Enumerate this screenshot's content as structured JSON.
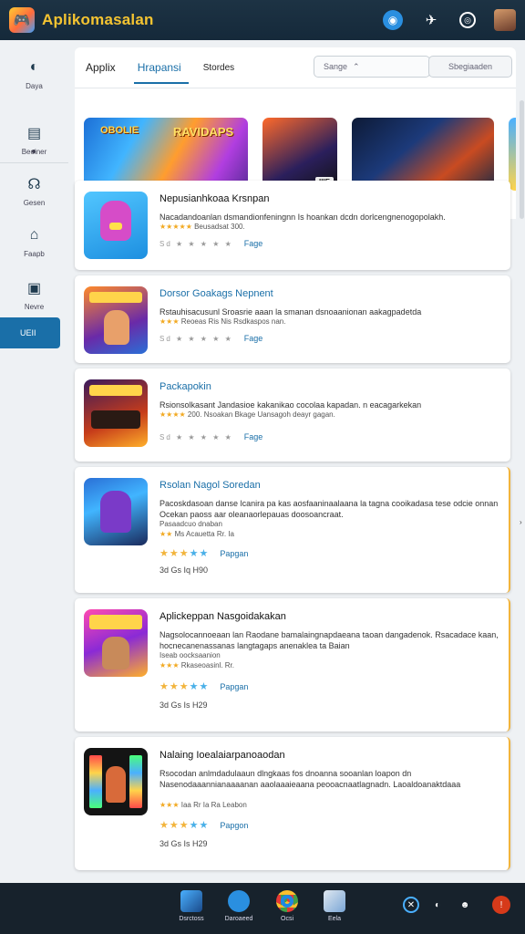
{
  "header": {
    "title": "Aplikomasalan",
    "icons": [
      "shield-icon",
      "rocket-icon",
      "copyright-icon",
      "user-avatar"
    ]
  },
  "sidebar": {
    "items": [
      {
        "label": "Daya",
        "icon": "compass-icon"
      },
      {
        "label": "Beoiner",
        "icon": "inbox-icon"
      },
      {
        "label": "Gesen",
        "icon": "headphones-icon"
      },
      {
        "label": "Faapb",
        "icon": "home-icon"
      },
      {
        "label": "Nevre",
        "icon": "book-icon"
      }
    ],
    "active_label": "UEII"
  },
  "tabs": [
    {
      "label": "Applix"
    },
    {
      "label": "Hrapansi"
    },
    {
      "label": "Stordes"
    }
  ],
  "search": {
    "value": "Sange",
    "button_label": "Sbegiaaden"
  },
  "banners": {
    "b1_text1": "OBOLIE",
    "b1_text2": "RAVIDAPS",
    "b2_tag": "IIIE"
  },
  "apps": [
    {
      "name": "Nepusianhkoaa Krsnpan",
      "desc": "Nacadandoanlan dsmandionfeningnn Is hoankan dcdn dorlcengnenogopolakh.",
      "meta_stars": "★★★★★",
      "meta_text": "Beusadsat 300.",
      "rating": "Sd ★ ★ ★ ★ ★",
      "page": "Fage"
    },
    {
      "name": "Dorsor Goakags Nepnent",
      "desc": "Rstauhisacusunl Sroasrie aaan la smanan dsnoaanionan aakagpadetda",
      "meta_stars": "★★★",
      "meta_text": "Reoeas  Ris  Nis  Rsdkaspos nan.",
      "rating": "Sd ★ ★ ★ ★ ★",
      "page": "Fage"
    },
    {
      "name": "Packapokin",
      "desc": "Rsionsolkasant Jandasioe kakanikao cocolaa kapadan. n eacagarkekan",
      "meta_stars": "★★★★",
      "meta_text": "Nsoakan Bkage Uansagoh deayr gagan.",
      "rating": "Sd ★ ★ ★ ★ ★",
      "page": "Fage",
      "size": "200."
    },
    {
      "name": "Rsolan Nagol Soredan",
      "desc": "Pacoskdasoan danse lcanira pa kas aosfaaninaalaana la tagna cooikadasa tese odcie onnan Ocekan paoss aar oleanaorlepauas doosoancraat.",
      "meta_text": "Pasaadcuo dnaban",
      "meta_stars": "★★",
      "meta_text2": "Ms Acauetta Rr. Ia",
      "rating": "★★★★★",
      "page": "Papgan",
      "size": "3d  Gs  Iq  H90"
    },
    {
      "name": "Aplickeppan Nasgoidakakan",
      "desc": "Nagsolocannoeaan lan Raodane  bamalaingnapdaeana taoan dangadenok. Rsacadace kaan, hocnecanenassanas langtagaps anenaklea ta Baian",
      "meta_text": "Iseab oocksaanion",
      "meta_stars": "★★★",
      "meta_text2": "Rkaseoasinl. Rr.",
      "rating": "★★★★★",
      "page": "Papgan",
      "size": "3d  Gs  Is  H29"
    },
    {
      "name": "Nalaing Ioealaiarpanoaodan",
      "desc": "Rsocodan anlmdadulaaun dlngkaas fos dnoanna sooanlan loapon dn Nasenodaaannianaaaanan aaolaaaieaana peooacnaatlagnadn. Laoaldoanaktdaaa",
      "meta_stars": "★★★",
      "meta_text": "Iaa  Rr  Ia  Ra Leabon",
      "rating": "★★★★★",
      "page": "Papgon",
      "size": "3d  Gs  Is  H29"
    }
  ],
  "taskbar": {
    "items": [
      {
        "label": "Dsrctoss"
      },
      {
        "label": "Daroaeed"
      },
      {
        "label": "Ocsi"
      },
      {
        "label": "Eela"
      }
    ]
  }
}
